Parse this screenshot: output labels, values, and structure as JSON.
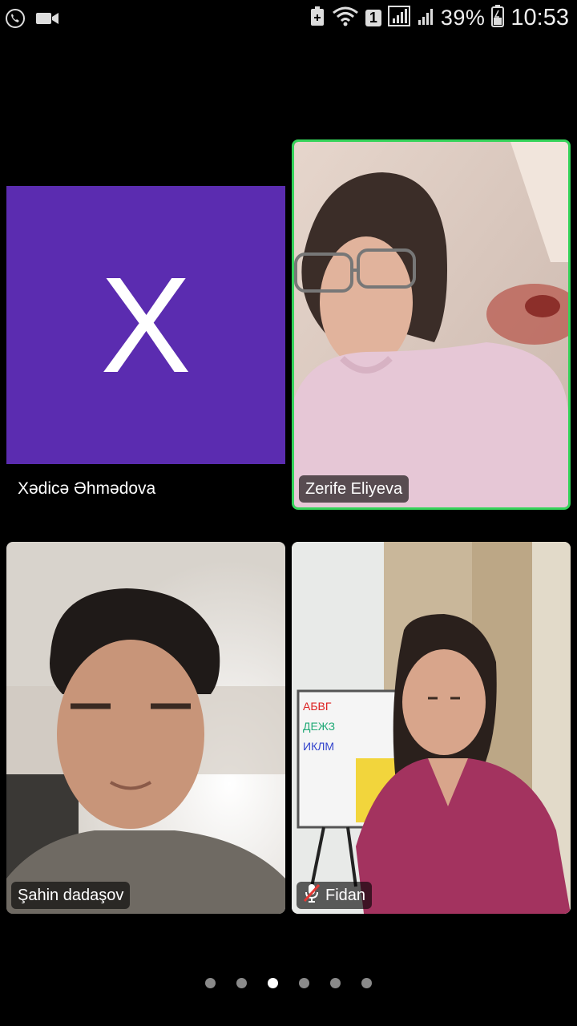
{
  "status_bar": {
    "battery_percent": "39%",
    "time": "10:53",
    "sim_slot": "1",
    "icons": [
      "call-in-progress-icon",
      "video-camera-icon",
      "battery-saver-icon",
      "wifi-icon",
      "signal-icon",
      "battery-icon"
    ]
  },
  "participants": [
    {
      "name": "Xədicə Əhmədova",
      "avatar_letter": "X",
      "video": false,
      "accent": "#5b2cb0"
    },
    {
      "name": "Zerife Eliyeva",
      "video": true,
      "speaking": true,
      "speaker_border": "#35d35a"
    },
    {
      "name": "Şahin dadaşov",
      "video": true
    },
    {
      "name": "Fidan",
      "video": true,
      "muted": true
    }
  ],
  "pager": {
    "pages": 6,
    "active_index": 2
  }
}
